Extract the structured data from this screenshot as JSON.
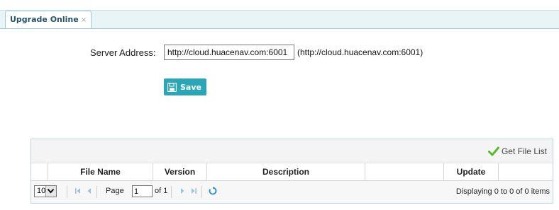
{
  "tabs": [
    {
      "label": "Upgrade Online",
      "close": "×"
    }
  ],
  "form": {
    "server_label": "Server Address:",
    "server_value": "http://cloud.huacenav.com:6001",
    "server_hint": "(http://cloud.huacenav.com:6001)",
    "save_label": "Save"
  },
  "grid": {
    "toolbar": {
      "get_file_list": "Get File List"
    },
    "columns": [
      "File Name",
      "Version",
      "Description",
      "",
      "Update"
    ],
    "pager": {
      "page_size": "10",
      "page_label": "Page",
      "page_value": "1",
      "of_label": "of 1",
      "displaying": "Displaying 0 to 0 of 0 items"
    }
  },
  "colors": {
    "accent": "#2aa6b6",
    "tab_text": "#245468",
    "border": "#b9d6dc"
  }
}
